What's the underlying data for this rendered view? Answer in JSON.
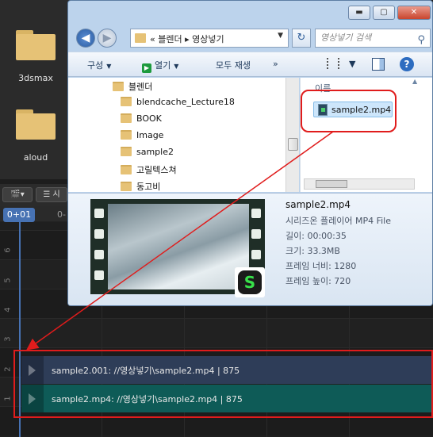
{
  "background": {
    "file_browser": {
      "folders": [
        "3dsmax",
        "aloud"
      ]
    },
    "sequencer": {
      "header_view_label": "",
      "header_select_label": "시",
      "frame_indicator": "0+01",
      "ruler_label": "0-",
      "channel_numbers": [
        "6",
        "5",
        "4",
        "3",
        "2",
        "1"
      ],
      "strips": [
        {
          "text": "sample2.001: //영상넣기\\sample2.mp4 | 875",
          "color": "#2e3d58"
        },
        {
          "text": "sample2.mp4: //영상넣기\\sample2.mp4 | 875",
          "color": "#0e5b57"
        }
      ]
    }
  },
  "explorer": {
    "window_controls": {
      "minimize": "▬",
      "maximize": "▢",
      "close": "✕"
    },
    "back_icon": "◀",
    "forward_icon": "▶",
    "address": {
      "path": "« 블렌더 ▸ 영상넣기",
      "dropdown_icon": "▼"
    },
    "refresh_icon": "↻",
    "search": {
      "placeholder": "영상넣기 검색",
      "icon": "⚲"
    },
    "command_bar": {
      "organize": "구성",
      "open": "열기",
      "play_all": "모두 재생",
      "more": "»"
    },
    "nav_tree": [
      "블렌더",
      "blendcache_Lecture18",
      "BOOK",
      "Image",
      "sample2",
      "고릴텍스쳐",
      "동고비"
    ],
    "file_list": {
      "column_header": "이름",
      "files": [
        "sample2.mp4"
      ]
    },
    "details": {
      "name": "sample2.mp4",
      "type": "시리즈온 플레이어 MP4 File",
      "length": "길이: 00:00:35",
      "size": "크기: 33.3MB",
      "frame_width": "프레임 너비: 1280",
      "frame_height": "프레임 높이: 720",
      "badge_letter": "S"
    }
  },
  "colors": {
    "highlight": "#e01c1c",
    "playhead": "#4772b3"
  }
}
